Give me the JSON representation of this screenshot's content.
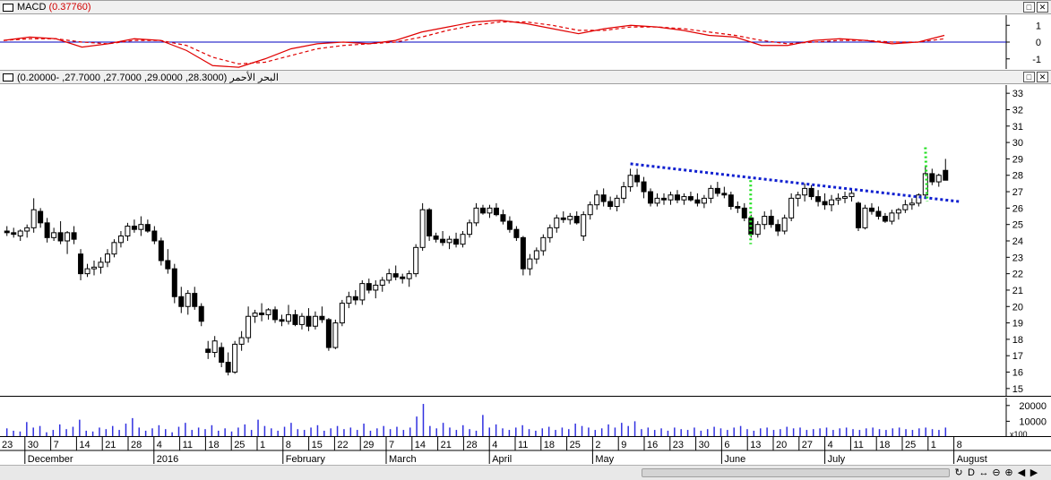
{
  "macd_panel": {
    "title": "MACD",
    "value": "(0.37760)",
    "y_ticks": [
      "1",
      "0",
      "-1"
    ],
    "colors": {
      "line": "#e00000",
      "signal": "#e00000",
      "zero": "#0000c0"
    }
  },
  "main_panel": {
    "title": "البحر الأحمر",
    "ohlc": "(28.3000, 29.0000, 27.7000, 27.7000, -0.20000)",
    "y_ticks": [
      "33",
      "32",
      "31",
      "30",
      "29",
      "28",
      "27",
      "26",
      "25",
      "24",
      "23",
      "22",
      "21",
      "20",
      "19",
      "18",
      "17",
      "16",
      "15"
    ]
  },
  "volume_panel": {
    "y_ticks": [
      "20000",
      "10000"
    ],
    "multiplier": "x100",
    "bar_color": "#3030e0"
  },
  "x_axis": {
    "day_ticks": [
      "23",
      "30",
      "7",
      "14",
      "21",
      "28",
      "4",
      "11",
      "18",
      "25",
      "1",
      "8",
      "15",
      "22",
      "29",
      "7",
      "14",
      "21",
      "28",
      "4",
      "11",
      "18",
      "25",
      "2",
      "9",
      "16",
      "23",
      "30",
      "6",
      "13",
      "20",
      "27",
      "4",
      "11",
      "18",
      "25",
      "1",
      "8"
    ],
    "month_labels": [
      "December",
      "2016",
      "February",
      "March",
      "April",
      "May",
      "June",
      "July",
      "August"
    ]
  },
  "window_buttons": {
    "restore": "□",
    "close": "✕"
  },
  "toolbar_icons": [
    "rotate-icon",
    "d-icon",
    "expand-icon",
    "zoom-out-icon",
    "zoom-in-icon",
    "scroll-left-icon",
    "scroll-right-icon"
  ],
  "toolbar_glyphs": [
    "↻",
    "D",
    "↔",
    "⊖",
    "⊕",
    "◀",
    "▶"
  ],
  "chart_data": [
    {
      "type": "line",
      "title": "MACD (0.37760)",
      "ylim": [
        -1.6,
        1.6
      ],
      "series": [
        {
          "name": "MACD",
          "values": [
            0.1,
            0.3,
            0.2,
            -0.3,
            -0.1,
            0.2,
            0.1,
            -0.5,
            -1.4,
            -1.5,
            -1.0,
            -0.4,
            -0.1,
            0.0,
            -0.1,
            0.1,
            0.6,
            0.9,
            1.2,
            1.3,
            1.1,
            0.8,
            0.5,
            0.8,
            1.0,
            0.9,
            0.7,
            0.4,
            0.3,
            -0.2,
            -0.2,
            0.1,
            0.2,
            0.1,
            -0.1,
            0.0,
            0.4
          ]
        },
        {
          "name": "Signal",
          "values": [
            0.1,
            0.2,
            0.2,
            0.0,
            -0.1,
            0.1,
            0.1,
            -0.2,
            -0.9,
            -1.3,
            -1.2,
            -0.8,
            -0.4,
            -0.2,
            -0.1,
            0.0,
            0.3,
            0.7,
            1.0,
            1.2,
            1.2,
            1.0,
            0.7,
            0.7,
            0.9,
            0.9,
            0.8,
            0.6,
            0.4,
            0.1,
            -0.1,
            0.0,
            0.1,
            0.1,
            0.0,
            0.0,
            0.2
          ]
        }
      ]
    },
    {
      "type": "candlestick",
      "ylim": [
        14.5,
        33.5
      ],
      "candles": [
        [
          24.6,
          24.9,
          24.3,
          24.5
        ],
        [
          24.5,
          24.8,
          24.2,
          24.4
        ],
        [
          24.3,
          24.7,
          24.0,
          24.6
        ],
        [
          24.6,
          25.0,
          24.2,
          24.8
        ],
        [
          24.8,
          26.6,
          24.5,
          25.9
        ],
        [
          25.8,
          26.0,
          24.8,
          25.1
        ],
        [
          25.1,
          25.4,
          23.9,
          24.2
        ],
        [
          24.2,
          24.8,
          24.0,
          24.5
        ],
        [
          24.5,
          25.2,
          23.8,
          24.0
        ],
        [
          24.0,
          24.6,
          23.2,
          24.5
        ],
        [
          24.5,
          24.9,
          23.8,
          24.1
        ],
        [
          23.2,
          23.5,
          21.6,
          22.0
        ],
        [
          22.0,
          22.6,
          21.8,
          22.3
        ],
        [
          22.3,
          22.8,
          21.9,
          22.4
        ],
        [
          22.4,
          23.0,
          22.0,
          22.7
        ],
        [
          22.7,
          23.5,
          22.4,
          23.2
        ],
        [
          23.2,
          24.1,
          23.0,
          23.9
        ],
        [
          23.9,
          24.6,
          23.6,
          24.3
        ],
        [
          24.3,
          25.1,
          24.0,
          24.9
        ],
        [
          24.9,
          25.3,
          24.5,
          24.7
        ],
        [
          24.7,
          25.5,
          24.3,
          25.0
        ],
        [
          25.0,
          25.3,
          24.5,
          24.6
        ],
        [
          24.6,
          24.9,
          23.8,
          24.0
        ],
        [
          24.0,
          24.2,
          22.5,
          22.8
        ],
        [
          22.8,
          23.5,
          22.0,
          22.3
        ],
        [
          22.3,
          22.6,
          20.2,
          20.6
        ],
        [
          20.6,
          21.2,
          19.6,
          20.0
        ],
        [
          20.0,
          21.0,
          19.5,
          20.8
        ],
        [
          20.8,
          21.2,
          19.8,
          20.0
        ],
        [
          20.0,
          20.2,
          18.8,
          19.1
        ],
        [
          17.4,
          17.9,
          16.8,
          17.2
        ],
        [
          17.2,
          18.2,
          16.9,
          17.9
        ],
        [
          17.5,
          17.8,
          16.3,
          16.6
        ],
        [
          16.6,
          17.2,
          15.8,
          16.0
        ],
        [
          16.0,
          17.9,
          15.9,
          17.7
        ],
        [
          17.7,
          18.5,
          17.3,
          18.1
        ],
        [
          18.1,
          20.0,
          17.8,
          19.4
        ],
        [
          19.4,
          19.8,
          19.0,
          19.6
        ],
        [
          19.6,
          20.2,
          19.1,
          19.5
        ],
        [
          19.5,
          19.9,
          19.2,
          19.8
        ],
        [
          19.8,
          20.0,
          19.0,
          19.2
        ],
        [
          19.2,
          19.5,
          18.8,
          19.1
        ],
        [
          19.1,
          20.1,
          18.9,
          19.5
        ],
        [
          19.5,
          19.8,
          18.8,
          18.9
        ],
        [
          18.9,
          19.6,
          18.6,
          19.4
        ],
        [
          19.4,
          19.9,
          18.5,
          18.8
        ],
        [
          18.8,
          19.7,
          18.6,
          19.4
        ],
        [
          19.4,
          20.0,
          19.0,
          19.2
        ],
        [
          19.2,
          19.3,
          17.3,
          17.5
        ],
        [
          17.5,
          19.2,
          17.4,
          19.0
        ],
        [
          19.0,
          20.4,
          18.8,
          20.2
        ],
        [
          20.2,
          20.9,
          19.9,
          20.6
        ],
        [
          20.6,
          21.0,
          20.1,
          20.4
        ],
        [
          20.4,
          21.6,
          20.1,
          21.4
        ],
        [
          21.4,
          21.7,
          20.8,
          21.0
        ],
        [
          21.0,
          21.6,
          20.5,
          21.3
        ],
        [
          21.3,
          21.8,
          20.9,
          21.6
        ],
        [
          21.6,
          22.3,
          21.4,
          22.0
        ],
        [
          22.0,
          22.5,
          21.6,
          21.8
        ],
        [
          21.8,
          22.0,
          21.4,
          21.7
        ],
        [
          21.7,
          22.2,
          21.2,
          22.0
        ],
        [
          22.0,
          23.8,
          21.8,
          23.6
        ],
        [
          23.6,
          26.3,
          23.4,
          25.9
        ],
        [
          25.9,
          26.0,
          24.0,
          24.3
        ],
        [
          24.3,
          24.5,
          23.9,
          24.1
        ],
        [
          24.1,
          24.6,
          23.7,
          23.9
        ],
        [
          23.9,
          24.3,
          23.5,
          24.1
        ],
        [
          24.1,
          24.5,
          23.6,
          23.8
        ],
        [
          23.8,
          24.6,
          23.6,
          24.4
        ],
        [
          24.4,
          25.3,
          24.2,
          25.1
        ],
        [
          25.1,
          26.3,
          24.9,
          26.0
        ],
        [
          26.0,
          26.2,
          25.6,
          25.7
        ],
        [
          25.7,
          26.2,
          25.4,
          26.0
        ],
        [
          26.0,
          26.3,
          25.5,
          25.6
        ],
        [
          25.6,
          25.9,
          25.0,
          25.2
        ],
        [
          25.2,
          25.5,
          24.5,
          24.7
        ],
        [
          24.7,
          24.9,
          24.0,
          24.2
        ],
        [
          24.2,
          24.3,
          21.9,
          22.3
        ],
        [
          22.3,
          23.2,
          21.9,
          22.9
        ],
        [
          22.9,
          23.6,
          22.6,
          23.4
        ],
        [
          23.4,
          24.4,
          23.1,
          24.2
        ],
        [
          24.2,
          25.0,
          23.9,
          24.8
        ],
        [
          24.8,
          25.6,
          24.5,
          25.4
        ],
        [
          25.4,
          25.8,
          25.1,
          25.3
        ],
        [
          25.3,
          25.7,
          25.0,
          25.5
        ],
        [
          25.5,
          25.8,
          25.0,
          25.1
        ],
        [
          24.3,
          25.8,
          24.0,
          25.6
        ],
        [
          25.6,
          26.4,
          25.3,
          26.2
        ],
        [
          26.2,
          27.1,
          25.9,
          26.8
        ],
        [
          26.8,
          27.2,
          26.1,
          26.4
        ],
        [
          26.4,
          26.7,
          25.9,
          26.1
        ],
        [
          26.1,
          26.8,
          25.8,
          26.6
        ],
        [
          26.6,
          27.6,
          26.3,
          27.3
        ],
        [
          27.3,
          28.4,
          27.0,
          28.0
        ],
        [
          28.0,
          28.4,
          27.3,
          27.6
        ],
        [
          27.6,
          27.9,
          26.6,
          27.0
        ],
        [
          27.0,
          27.2,
          26.1,
          26.3
        ],
        [
          26.3,
          26.9,
          26.1,
          26.6
        ],
        [
          26.6,
          26.9,
          26.2,
          26.5
        ],
        [
          26.5,
          27.0,
          26.2,
          26.8
        ],
        [
          26.8,
          27.1,
          26.3,
          26.5
        ],
        [
          26.5,
          26.9,
          26.2,
          26.7
        ],
        [
          26.7,
          27.0,
          26.4,
          26.5
        ],
        [
          26.5,
          26.9,
          26.1,
          26.3
        ],
        [
          26.3,
          26.8,
          26.0,
          26.6
        ],
        [
          26.6,
          27.4,
          26.3,
          27.2
        ],
        [
          27.2,
          27.6,
          26.7,
          26.9
        ],
        [
          26.9,
          27.3,
          26.6,
          26.8
        ],
        [
          26.8,
          27.0,
          25.9,
          26.1
        ],
        [
          26.1,
          26.4,
          25.7,
          26.0
        ],
        [
          26.0,
          26.3,
          25.2,
          25.4
        ],
        [
          25.4,
          25.6,
          24.2,
          24.4
        ],
        [
          24.4,
          25.2,
          24.2,
          25.0
        ],
        [
          25.0,
          25.8,
          24.7,
          25.5
        ],
        [
          25.5,
          25.9,
          24.8,
          25.0
        ],
        [
          25.0,
          25.3,
          24.3,
          24.6
        ],
        [
          24.6,
          25.6,
          24.4,
          25.4
        ],
        [
          25.4,
          26.9,
          25.2,
          26.6
        ],
        [
          26.6,
          27.0,
          26.1,
          26.8
        ],
        [
          26.8,
          27.5,
          26.4,
          27.2
        ],
        [
          27.2,
          27.4,
          26.5,
          26.7
        ],
        [
          26.7,
          27.1,
          26.1,
          26.4
        ],
        [
          26.4,
          26.9,
          25.9,
          26.2
        ],
        [
          26.2,
          26.8,
          25.8,
          26.5
        ],
        [
          26.5,
          26.9,
          26.2,
          26.6
        ],
        [
          26.6,
          27.0,
          26.3,
          26.7
        ],
        [
          26.7,
          27.2,
          26.4,
          26.9
        ],
        [
          26.3,
          26.4,
          24.6,
          24.8
        ],
        [
          24.8,
          26.2,
          24.7,
          26.0
        ],
        [
          26.0,
          26.3,
          25.6,
          25.8
        ],
        [
          25.8,
          26.1,
          25.3,
          25.5
        ],
        [
          25.5,
          25.7,
          25.1,
          25.2
        ],
        [
          25.2,
          25.9,
          25.0,
          25.7
        ],
        [
          25.7,
          26.0,
          25.3,
          25.9
        ],
        [
          25.9,
          26.5,
          25.7,
          26.2
        ],
        [
          26.2,
          26.6,
          25.9,
          26.3
        ],
        [
          26.3,
          26.9,
          26.1,
          26.8
        ],
        [
          26.8,
          28.5,
          26.6,
          28.1
        ],
        [
          28.1,
          28.4,
          27.4,
          27.6
        ],
        [
          27.6,
          28.1,
          27.3,
          28.0
        ],
        [
          28.3,
          29.0,
          27.7,
          27.7
        ]
      ]
    },
    {
      "type": "bar",
      "values": [
        55,
        40,
        35,
        95,
        60,
        70,
        30,
        45,
        80,
        50,
        65,
        110,
        40,
        35,
        60,
        50,
        70,
        45,
        85,
        120,
        60,
        40,
        55,
        75,
        50,
        30,
        65,
        90,
        45,
        60,
        50,
        75,
        40,
        55,
        35,
        60,
        80,
        45,
        110,
        70,
        55,
        40,
        65,
        90,
        50,
        45,
        60,
        75,
        40,
        55,
        70,
        50,
        60,
        45,
        85,
        40,
        55,
        70,
        50,
        65,
        45,
        60,
        130,
        210,
        70,
        55,
        90,
        60,
        45,
        75,
        50,
        40,
        140,
        60,
        80,
        55,
        45,
        60,
        75,
        50,
        40,
        55,
        65,
        45,
        60,
        50,
        85,
        70,
        60,
        45,
        55,
        80,
        60,
        90,
        70,
        100,
        50,
        60,
        45,
        55,
        40,
        60,
        50,
        45,
        60,
        40,
        50,
        65,
        55,
        45,
        60,
        70,
        50,
        40,
        55,
        60,
        45,
        50,
        65,
        55,
        60,
        45,
        50,
        55,
        60,
        45,
        55,
        60,
        50,
        45,
        55,
        60,
        50,
        45,
        55,
        60,
        50,
        45,
        55,
        60,
        50,
        45,
        60
      ]
    }
  ]
}
